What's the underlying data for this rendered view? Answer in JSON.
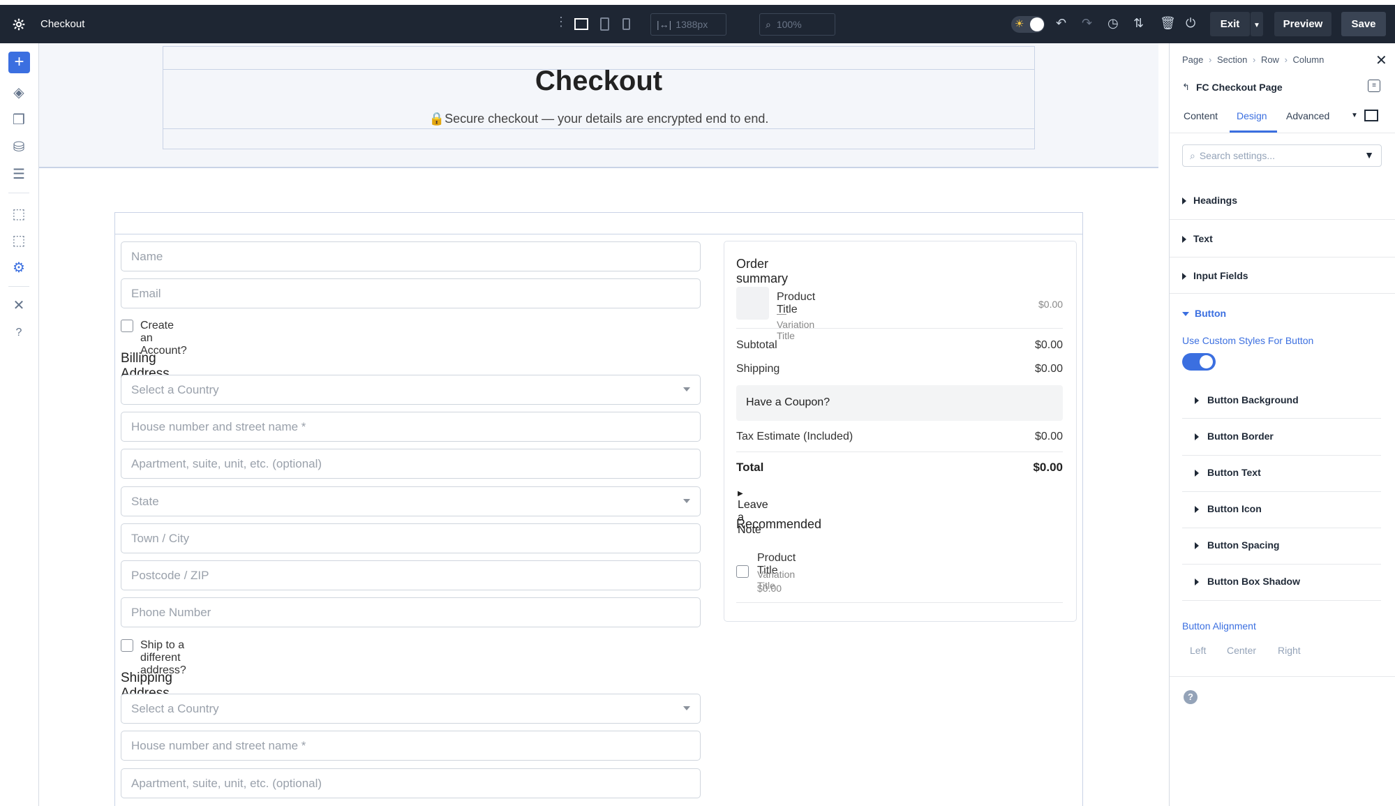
{
  "topbar": {
    "title": "Checkout",
    "width_value": "1388px",
    "zoom_value": "100%",
    "exit_label": "Exit",
    "preview_label": "Preview",
    "save_label": "Save"
  },
  "page": {
    "heading": "Checkout",
    "secure_note": "Secure checkout — your details are encrypted end to end."
  },
  "form": {
    "name_ph": "Name",
    "email_ph": "Email",
    "create_account": "Create an Account?",
    "billing_heading": "Billing Address",
    "country_ph": "Select a Country",
    "street_ph": "House number and street name *",
    "apartment_ph": "Apartment, suite, unit, etc. (optional)",
    "state_ph": "State",
    "city_ph": "Town / City",
    "postcode_ph": "Postcode / ZIP",
    "phone_ph": "Phone Number",
    "ship_different": "Ship to a different address?",
    "shipping_heading": "Shipping Address",
    "ship_country_ph": "Select a Country",
    "ship_street_ph": "House number and street name *",
    "ship_apartment_ph": "Apartment, suite, unit, etc. (optional)"
  },
  "summary": {
    "title": "Order summary",
    "product_title": "Product Title",
    "variation": "— Variation Title",
    "product_price": "$0.00",
    "subtotal_label": "Subtotal",
    "subtotal_value": "$0.00",
    "shipping_label": "Shipping",
    "shipping_value": "$0.00",
    "coupon": "Have a Coupon?",
    "tax_label": "Tax Estimate (Included)",
    "tax_value": "$0.00",
    "total_label": "Total",
    "total_value": "$0.00",
    "note": "Leave a Note",
    "recommended": "Recommended",
    "rec_title": "Product Title",
    "rec_variation": "Variation Title",
    "rec_price": "$0.00"
  },
  "panel": {
    "breadcrumb": [
      "Page",
      "Section",
      "Row",
      "Column"
    ],
    "element_title": "FC Checkout Page",
    "tabs": [
      "Content",
      "Design",
      "Advanced"
    ],
    "active_tab": "Design",
    "search_ph": "Search settings...",
    "sections": [
      "Headings",
      "Text",
      "Input Fields"
    ],
    "button_section": "Button",
    "custom_styles_label": "Use Custom Styles For Button",
    "custom_styles_on": true,
    "button_groups": [
      "Button Background",
      "Button Border",
      "Button Text",
      "Button Icon",
      "Button Spacing",
      "Button Box Shadow"
    ],
    "alignment_label": "Button Alignment",
    "alignment_options": [
      "Left",
      "Center",
      "Right"
    ]
  },
  "colors": {
    "accent": "#3b6fe0",
    "topbar_bg": "#1e2633"
  }
}
